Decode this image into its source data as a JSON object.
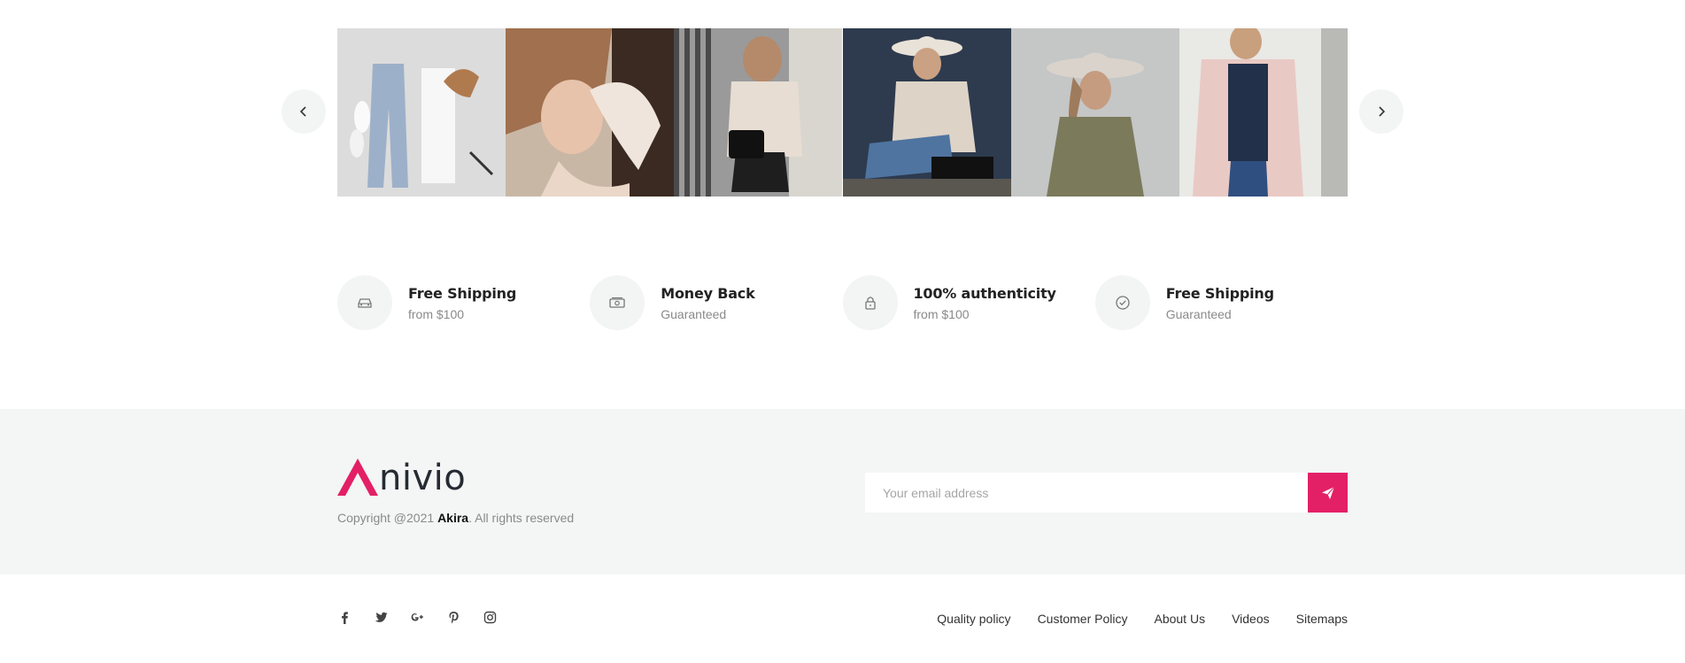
{
  "gallery": {
    "prev_icon": "chevron-left-icon",
    "next_icon": "chevron-right-icon",
    "photos": [
      "flat-lay outfit: jeans, white shirt, sneakers, tan cap",
      "woman lying in fur",
      "woman with black bag on street",
      "woman in hat sitting with phone",
      "woman in hat, olive shirt",
      "woman in pink coat"
    ]
  },
  "features": [
    {
      "icon": "car-icon",
      "title": "Free Shipping",
      "subtitle": "from $100"
    },
    {
      "icon": "money-icon",
      "title": "Money Back",
      "subtitle": "Guaranteed"
    },
    {
      "icon": "lock-icon",
      "title": "100% authenticity",
      "subtitle": "from $100"
    },
    {
      "icon": "check-circle-icon",
      "title": "Free Shipping",
      "subtitle": "Guaranteed"
    }
  ],
  "footer": {
    "logo_letter": "A",
    "logo_text": "nivio",
    "copyright_prefix": "Copyright @2021 ",
    "copyright_brand": "Akira",
    "copyright_suffix": ". All rights reserved",
    "email_placeholder": "Your email address",
    "send_icon": "paper-plane-icon",
    "accent_color": "#e32065",
    "social": [
      "facebook-icon",
      "twitter-icon",
      "google-plus-icon",
      "pinterest-icon",
      "instagram-icon"
    ],
    "links": [
      "Quality policy",
      "Customer Policy",
      "About Us",
      "Videos",
      "Sitemaps"
    ]
  }
}
